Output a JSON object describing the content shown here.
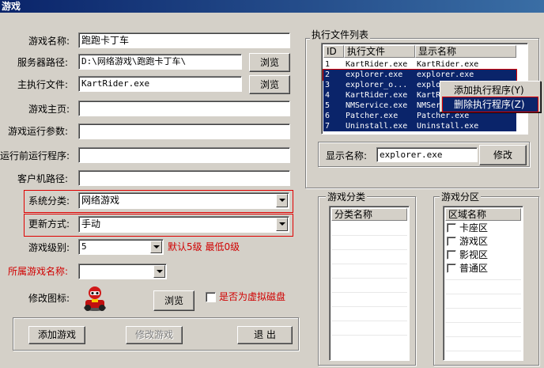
{
  "window": {
    "title": "游戏"
  },
  "form": {
    "game_name_label": "游戏名称:",
    "game_name_value": "跑跑卡丁车",
    "server_path_label": "服务器路径:",
    "server_path_value": "D:\\网络游戏\\跑跑卡丁车\\",
    "main_exe_label": "主执行文件:",
    "main_exe_value": "KartRider.exe",
    "homepage_label": "游戏主页:",
    "homepage_value": "",
    "run_params_label": "游戏运行参数:",
    "run_params_value": "",
    "pre_run_label": "运行前运行程序:",
    "pre_run_value": "",
    "client_path_label": "客户机路径:",
    "client_path_value": "",
    "category_label": "系统分类:",
    "category_value": "网络游戏",
    "update_label": "更新方式:",
    "update_value": "手动",
    "level_label": "游戏级别:",
    "level_value": "5",
    "level_hint": "默认5级   最低0级",
    "parent_game_label": "所属游戏名称:",
    "parent_game_value": "",
    "icon_label": "修改图标:",
    "browse_label": "浏览",
    "virtual_disk_label": "是否为虚拟磁盘",
    "virtual_disk_checked": false
  },
  "buttons": {
    "add_game": "添加游戏",
    "modify_game": "修改游戏",
    "exit": "退  出",
    "modify": "修改"
  },
  "exec_list": {
    "title": "执行文件列表",
    "columns": [
      "ID",
      "执行文件",
      "显示名称"
    ],
    "rows": [
      {
        "id": "1",
        "file": "KartRider.exe",
        "name": "KartRider.exe",
        "selected": false
      },
      {
        "id": "2",
        "file": "explorer.exe",
        "name": "explorer.exe",
        "selected": true
      },
      {
        "id": "3",
        "file": "explorer_o...",
        "name": "explo",
        "selected": true
      },
      {
        "id": "4",
        "file": "KartRider.exe",
        "name": "KartR",
        "selected": true
      },
      {
        "id": "5",
        "file": "NMService.exe",
        "name": "NMSer",
        "selected": true
      },
      {
        "id": "6",
        "file": "Patcher.exe",
        "name": "Patcher.exe",
        "selected": true
      },
      {
        "id": "7",
        "file": "Uninstall.exe",
        "name": "Uninstall.exe",
        "selected": true
      }
    ],
    "display_name_label": "显示名称:",
    "display_name_value": "explorer.exe"
  },
  "context_menu": {
    "items": [
      "添加执行程序(Y)",
      "删除执行程序(Z)"
    ]
  },
  "category_group": {
    "title": "游戏分类",
    "header": "分类名称",
    "items": []
  },
  "zone_group": {
    "title": "游戏分区",
    "header": "区域名称",
    "items": [
      "卡座区",
      "游戏区",
      "影视区",
      "普通区"
    ]
  },
  "colors": {
    "highlight": "#0a246a",
    "red_outline": "#e00000",
    "red_text": "#d00000"
  }
}
